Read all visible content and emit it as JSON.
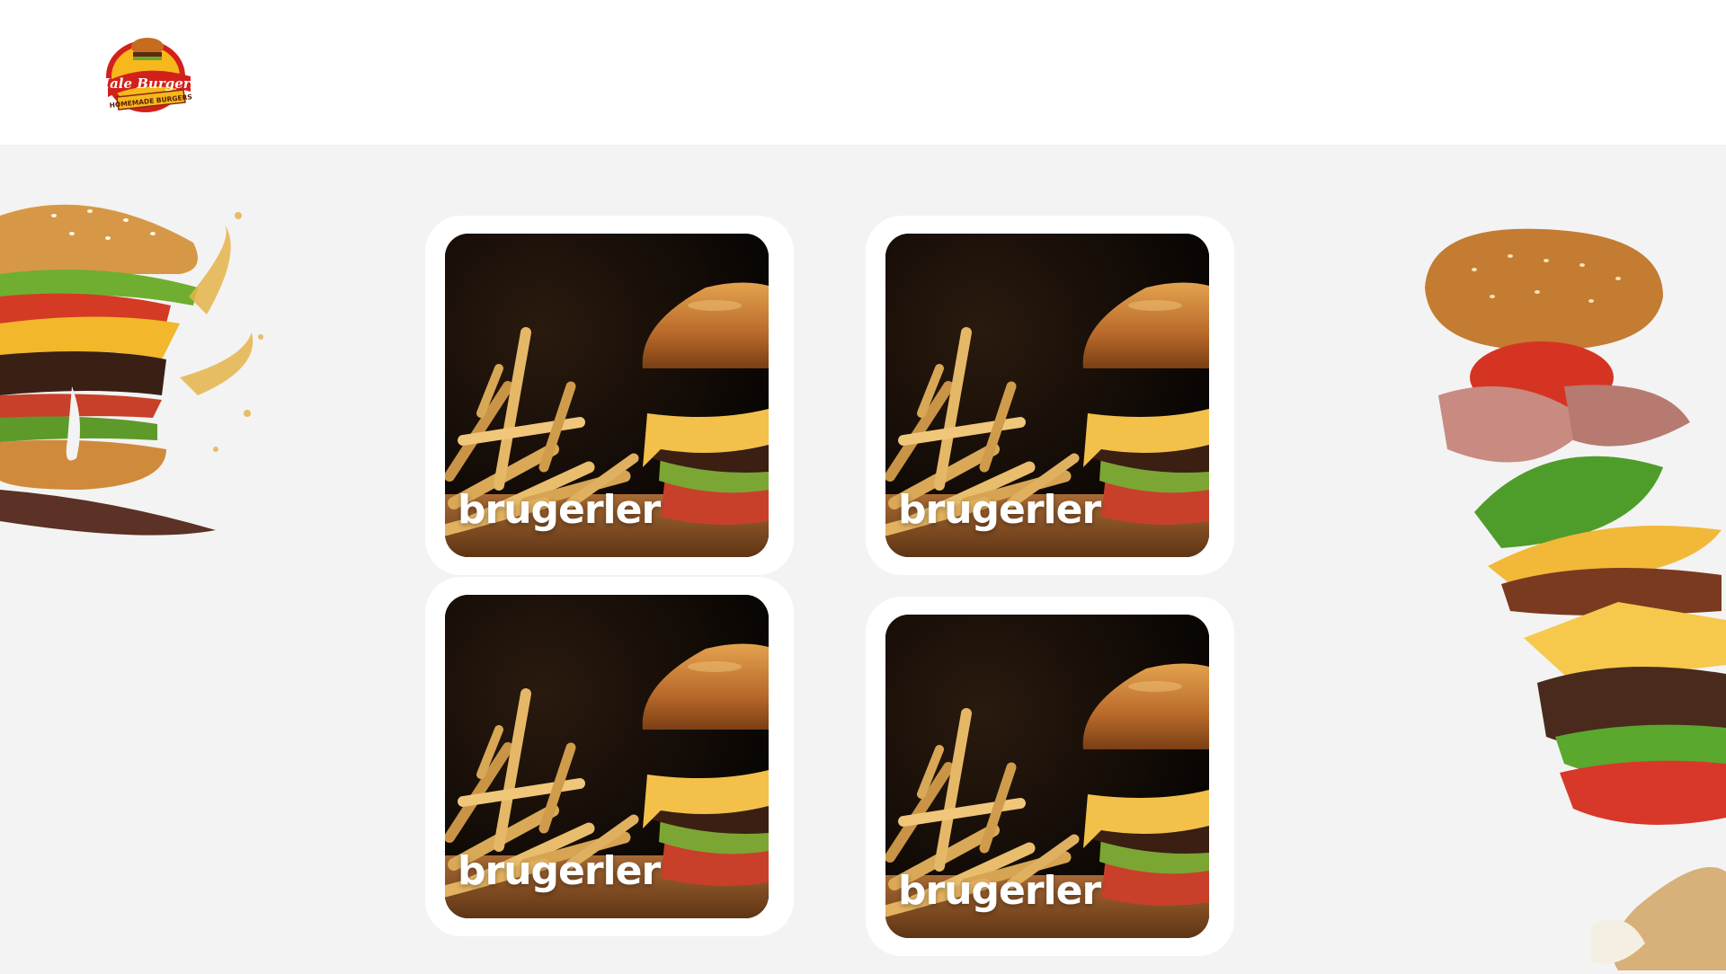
{
  "header": {
    "logo": {
      "icon": "hale-burgers-logo",
      "brand_text": "Hale Burgers",
      "tagline": "HOMEMADE BURGERS"
    }
  },
  "decorations": {
    "left_icon": "splashing-burger-image",
    "right_icon": "floating-burger-ingredients-image"
  },
  "cards": [
    {
      "label": "brugerler",
      "image": "burger-and-fries-photo"
    },
    {
      "label": "brugerler",
      "image": "burger-and-fries-photo"
    },
    {
      "label": "brugerler",
      "image": "burger-and-fries-photo"
    },
    {
      "label": "brugerler",
      "image": "burger-and-fries-photo"
    }
  ],
  "colors": {
    "page_background": "#f3f3f3",
    "header_background": "#ffffff",
    "card_background": "#ffffff",
    "label_text": "#ffffff",
    "logo_red": "#d3201b",
    "logo_yellow": "#f6b81c"
  }
}
